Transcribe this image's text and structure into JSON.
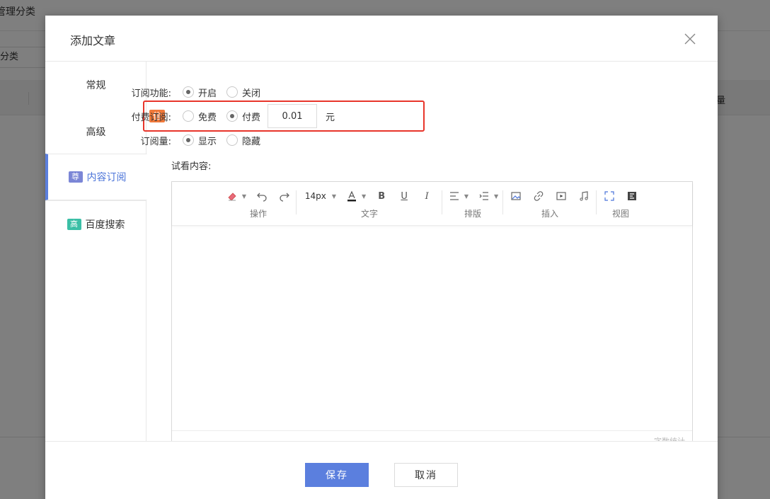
{
  "background": {
    "page_title": "管理分类",
    "filter_label": "分类",
    "table_header_right": "量"
  },
  "modal": {
    "title": "添加文章",
    "sidebar": {
      "items": [
        {
          "label": "常规",
          "badge": ""
        },
        {
          "label": "高级",
          "badge": ""
        },
        {
          "label": "内容订阅",
          "badge": "尊",
          "badge_color": "#7b86d6"
        },
        {
          "label": "百度搜索",
          "badge": "高",
          "badge_color": "#3bbfa6"
        }
      ],
      "active_index": 2
    },
    "form": {
      "subscribe": {
        "label": "订阅功能:",
        "options": [
          "开启",
          "关闭"
        ],
        "selected": "开启"
      },
      "paid": {
        "badge": "信",
        "label": "付费订阅:",
        "options": [
          "免费",
          "付费"
        ],
        "selected": "付费",
        "price": "0.01",
        "unit": "元"
      },
      "count": {
        "label": "订阅量:",
        "options": [
          "显示",
          "隐藏"
        ],
        "selected": "显示"
      },
      "preview_label": "试看内容:"
    },
    "editor": {
      "font_size": "14px",
      "groups": [
        "操作",
        "文字",
        "排版",
        "插入",
        "视图"
      ],
      "word_count_label": "字数统计"
    },
    "footer": {
      "save_label": "保存",
      "cancel_label": "取消"
    }
  },
  "colors": {
    "primary": "#5b7fde",
    "highlight": "#e8352b",
    "vip_badge": "#f0793a"
  }
}
